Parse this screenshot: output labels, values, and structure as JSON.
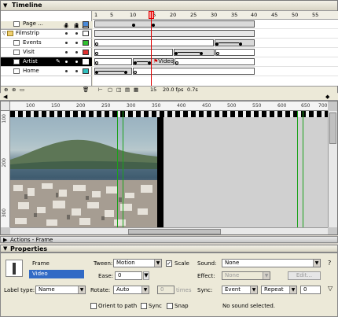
{
  "timeline": {
    "title": "Timeline",
    "ruler_ticks": [
      "1",
      "5",
      "10",
      "15",
      "20",
      "25",
      "30",
      "35",
      "40",
      "45",
      "50",
      "55"
    ],
    "layers": [
      {
        "label": "Page ...",
        "color": "#4a8ad8"
      },
      {
        "label": "Filmstrip",
        "color": ""
      },
      {
        "label": "Events",
        "color": "#30c030"
      },
      {
        "label": "Visit",
        "color": "#e03030"
      },
      {
        "label": "Artist",
        "color": "#ffffff"
      },
      {
        "label": "Home",
        "color": "#30c0c0"
      }
    ],
    "frame_label": "Video",
    "status": {
      "frame": "15",
      "fps": "20.0 fps",
      "time": "0.7s"
    }
  },
  "stage": {
    "h_ruler": [
      "100",
      "150",
      "200",
      "250",
      "300",
      "350",
      "400",
      "450",
      "500",
      "550",
      "600",
      "650",
      "700"
    ],
    "v_ruler": [
      "100",
      "200",
      "300"
    ]
  },
  "panels": {
    "actions": "Actions - Frame",
    "properties": "Properties"
  },
  "properties": {
    "frame_label": "Frame",
    "frame_name": "Video",
    "label_type_label": "Label type:",
    "label_type_value": "Name",
    "tween_label": "Tween:",
    "tween_value": "Motion",
    "scale_label": "Scale",
    "ease_label": "Ease:",
    "ease_value": "0",
    "rotate_label": "Rotate:",
    "rotate_value": "Auto",
    "times_value": "0",
    "times_label": "times",
    "orient_label": "Orient to path",
    "sync_cb_label": "Sync",
    "snap_label": "Snap",
    "sound_label": "Sound:",
    "sound_value": "None",
    "effect_label": "Effect:",
    "effect_value": "None",
    "edit_label": "Edit...",
    "sync_label": "Sync:",
    "sync_value": "Event",
    "repeat_value": "Repeat",
    "repeat_count": "0",
    "no_sound": "No sound selected."
  }
}
